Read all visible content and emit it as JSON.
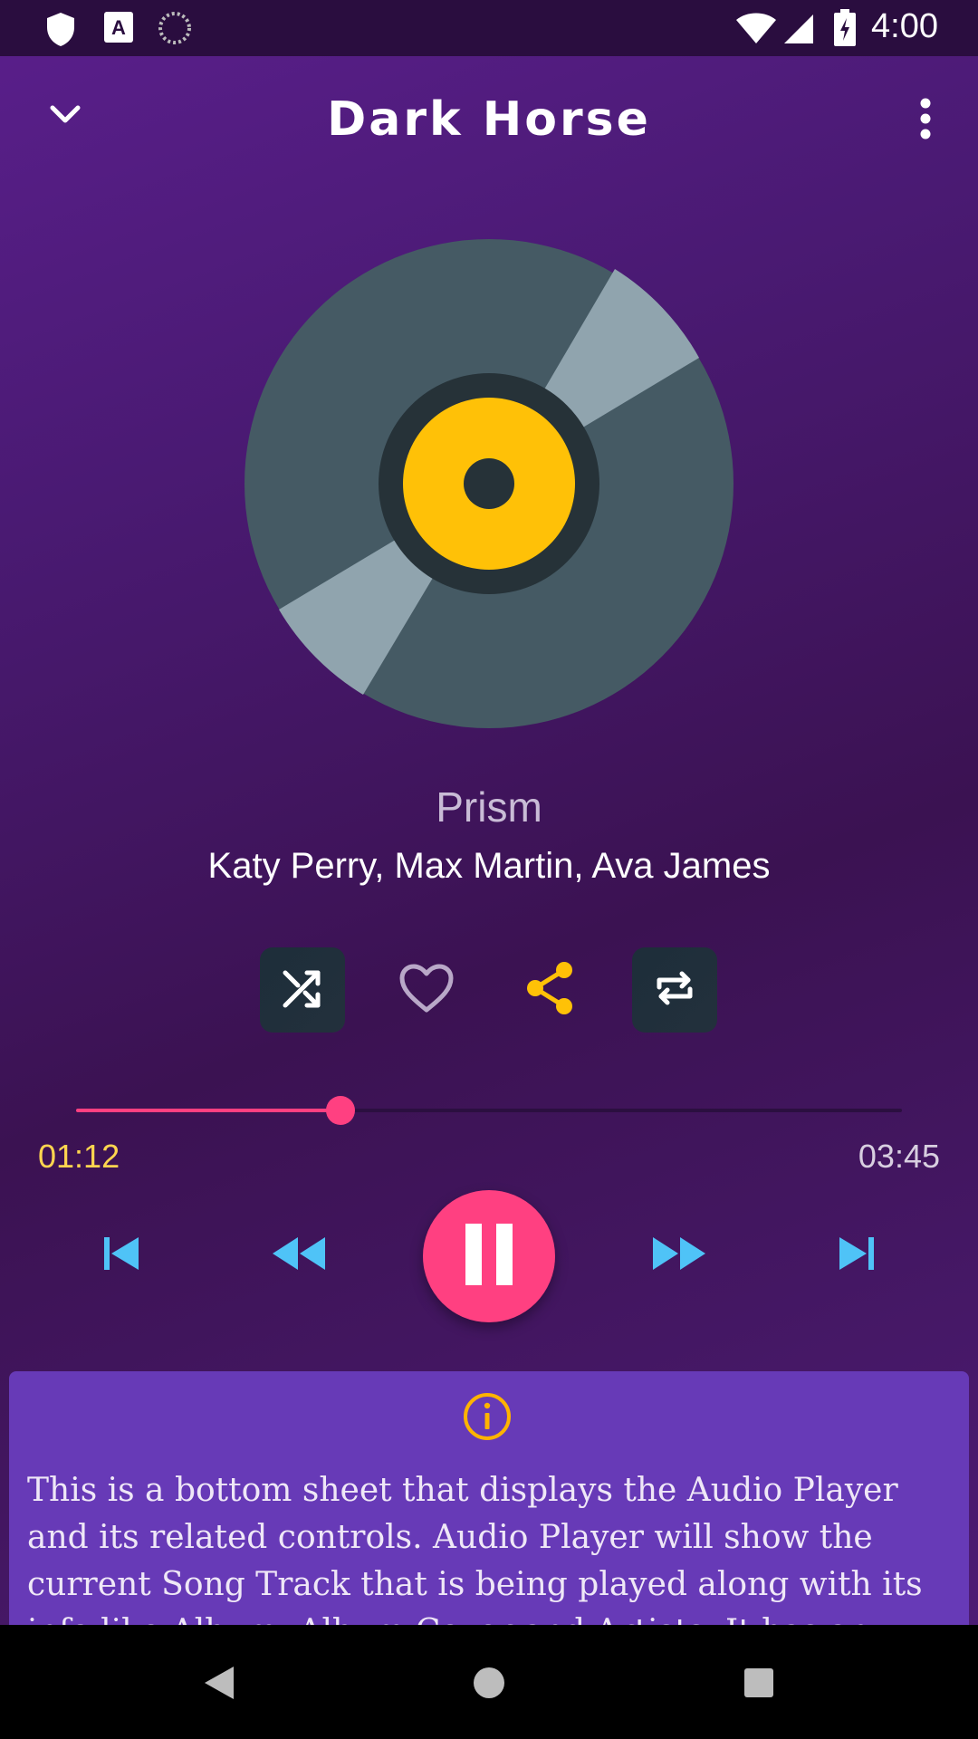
{
  "status_bar": {
    "time": "4:00",
    "left_icons": [
      "shield-icon",
      "font-icon",
      "sync-icon"
    ],
    "right_icons": [
      "wifi-icon",
      "signal-icon",
      "battery-icon"
    ]
  },
  "header": {
    "title": "Dark Horse",
    "collapse_icon": "chevron-down-icon",
    "menu_icon": "more-vert-icon"
  },
  "track": {
    "album": "Prism",
    "artists": "Katy Perry, Max Martin, Ava James",
    "elapsed": "01:12",
    "duration": "03:45",
    "progress_fraction": 0.32
  },
  "actions": [
    "shuffle-icon",
    "heart-icon",
    "share-icon",
    "repeat-icon"
  ],
  "playback": [
    "skip-previous-icon",
    "rewind-icon",
    "pause-icon",
    "fast-forward-icon",
    "skip-next-icon"
  ],
  "sheet": {
    "icon": "info-icon",
    "text": "This is a bottom sheet that displays the Audio Player and its related controls. Audio Player will show the current Song Track that is being played along with its info like Album, Album Cover and Artists. It has an interactive"
  },
  "colors": {
    "accent": "#ff4081",
    "disc_outer": "#455a64",
    "disc_stripe": "#90a4ae",
    "disc_label": "#ffc107",
    "sheet_bg": "#673ab7",
    "time_current": "#ffd54f",
    "playback_controls": "#4fc3f7"
  }
}
